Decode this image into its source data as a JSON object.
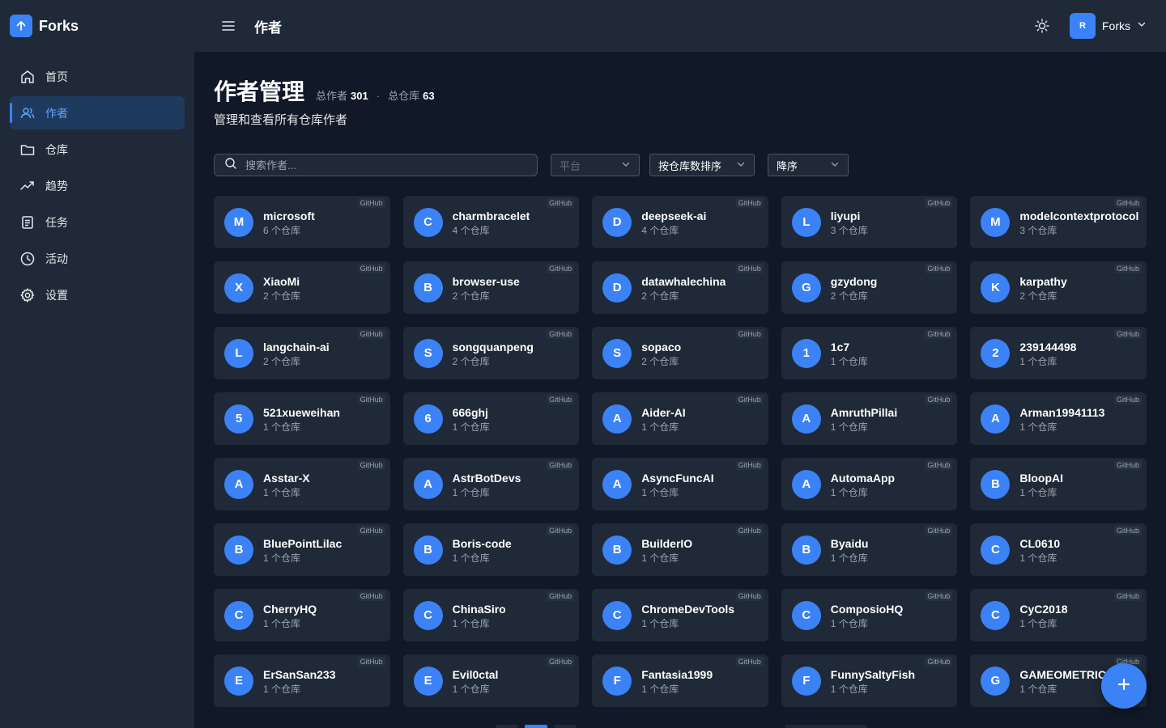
{
  "app": {
    "name": "Forks",
    "accent": "#3b82f6"
  },
  "sidebar": {
    "items": [
      {
        "label": "首页",
        "icon": "home-icon",
        "active": false
      },
      {
        "label": "作者",
        "icon": "users-icon",
        "active": true
      },
      {
        "label": "仓库",
        "icon": "folder-icon",
        "active": false
      },
      {
        "label": "趋势",
        "icon": "trend-icon",
        "active": false
      },
      {
        "label": "任务",
        "icon": "task-icon",
        "active": false
      },
      {
        "label": "活动",
        "icon": "clock-icon",
        "active": false
      },
      {
        "label": "设置",
        "icon": "gear-icon",
        "active": false
      }
    ]
  },
  "header": {
    "title": "作者",
    "user": {
      "avatar_text": "R",
      "name": "Forks"
    }
  },
  "page": {
    "title": "作者管理",
    "stats": {
      "authors_label": "总作者",
      "authors_value": "301",
      "repos_label": "总仓库",
      "repos_value": "63"
    },
    "subtitle": "管理和查看所有仓库作者"
  },
  "filters": {
    "search_placeholder": "搜索作者...",
    "platform_placeholder": "平台",
    "sort_value": "按仓库数排序",
    "order_value": "降序"
  },
  "authors": [
    {
      "initial": "M",
      "name": "microsoft",
      "count": "6 个仓库",
      "platform": "GitHub"
    },
    {
      "initial": "C",
      "name": "charmbracelet",
      "count": "4 个仓库",
      "platform": "GitHub"
    },
    {
      "initial": "D",
      "name": "deepseek-ai",
      "count": "4 个仓库",
      "platform": "GitHub"
    },
    {
      "initial": "L",
      "name": "liyupi",
      "count": "3 个仓库",
      "platform": "GitHub"
    },
    {
      "initial": "M",
      "name": "modelcontextprotocol",
      "count": "3 个仓库",
      "platform": "GitHub"
    },
    {
      "initial": "X",
      "name": "XiaoMi",
      "count": "2 个仓库",
      "platform": "GitHub"
    },
    {
      "initial": "B",
      "name": "browser-use",
      "count": "2 个仓库",
      "platform": "GitHub"
    },
    {
      "initial": "D",
      "name": "datawhalechina",
      "count": "2 个仓库",
      "platform": "GitHub"
    },
    {
      "initial": "G",
      "name": "gzydong",
      "count": "2 个仓库",
      "platform": "GitHub"
    },
    {
      "initial": "K",
      "name": "karpathy",
      "count": "2 个仓库",
      "platform": "GitHub"
    },
    {
      "initial": "L",
      "name": "langchain-ai",
      "count": "2 个仓库",
      "platform": "GitHub"
    },
    {
      "initial": "S",
      "name": "songquanpeng",
      "count": "2 个仓库",
      "platform": "GitHub"
    },
    {
      "initial": "S",
      "name": "sopaco",
      "count": "2 个仓库",
      "platform": "GitHub"
    },
    {
      "initial": "1",
      "name": "1c7",
      "count": "1 个仓库",
      "platform": "GitHub"
    },
    {
      "initial": "2",
      "name": "239144498",
      "count": "1 个仓库",
      "platform": "GitHub"
    },
    {
      "initial": "5",
      "name": "521xueweihan",
      "count": "1 个仓库",
      "platform": "GitHub"
    },
    {
      "initial": "6",
      "name": "666ghj",
      "count": "1 个仓库",
      "platform": "GitHub"
    },
    {
      "initial": "A",
      "name": "Aider-AI",
      "count": "1 个仓库",
      "platform": "GitHub"
    },
    {
      "initial": "A",
      "name": "AmruthPillai",
      "count": "1 个仓库",
      "platform": "GitHub"
    },
    {
      "initial": "A",
      "name": "Arman19941113",
      "count": "1 个仓库",
      "platform": "GitHub"
    },
    {
      "initial": "A",
      "name": "Asstar-X",
      "count": "1 个仓库",
      "platform": "GitHub"
    },
    {
      "initial": "A",
      "name": "AstrBotDevs",
      "count": "1 个仓库",
      "platform": "GitHub"
    },
    {
      "initial": "A",
      "name": "AsyncFuncAI",
      "count": "1 个仓库",
      "platform": "GitHub"
    },
    {
      "initial": "A",
      "name": "AutomaApp",
      "count": "1 个仓库",
      "platform": "GitHub"
    },
    {
      "initial": "B",
      "name": "BloopAI",
      "count": "1 个仓库",
      "platform": "GitHub"
    },
    {
      "initial": "B",
      "name": "BluePointLilac",
      "count": "1 个仓库",
      "platform": "GitHub"
    },
    {
      "initial": "B",
      "name": "Boris-code",
      "count": "1 个仓库",
      "platform": "GitHub"
    },
    {
      "initial": "B",
      "name": "BuilderIO",
      "count": "1 个仓库",
      "platform": "GitHub"
    },
    {
      "initial": "B",
      "name": "Byaidu",
      "count": "1 个仓库",
      "platform": "GitHub"
    },
    {
      "initial": "C",
      "name": "CL0610",
      "count": "1 个仓库",
      "platform": "GitHub"
    },
    {
      "initial": "C",
      "name": "CherryHQ",
      "count": "1 个仓库",
      "platform": "GitHub"
    },
    {
      "initial": "C",
      "name": "ChinaSiro",
      "count": "1 个仓库",
      "platform": "GitHub"
    },
    {
      "initial": "C",
      "name": "ChromeDevTools",
      "count": "1 个仓库",
      "platform": "GitHub"
    },
    {
      "initial": "C",
      "name": "ComposioHQ",
      "count": "1 个仓库",
      "platform": "GitHub"
    },
    {
      "initial": "C",
      "name": "CyC2018",
      "count": "1 个仓库",
      "platform": "GitHub"
    },
    {
      "initial": "E",
      "name": "ErSanSan233",
      "count": "1 个仓库",
      "platform": "GitHub"
    },
    {
      "initial": "E",
      "name": "Evil0ctal",
      "count": "1 个仓库",
      "platform": "GitHub"
    },
    {
      "initial": "F",
      "name": "Fantasia1999",
      "count": "1 个仓库",
      "platform": "GitHub"
    },
    {
      "initial": "F",
      "name": "FunnySaltyFish",
      "count": "1 个仓库",
      "platform": "GitHub"
    },
    {
      "initial": "G",
      "name": "GAMEOMETRICS",
      "count": "1 个仓库",
      "platform": "GitHub"
    }
  ]
}
